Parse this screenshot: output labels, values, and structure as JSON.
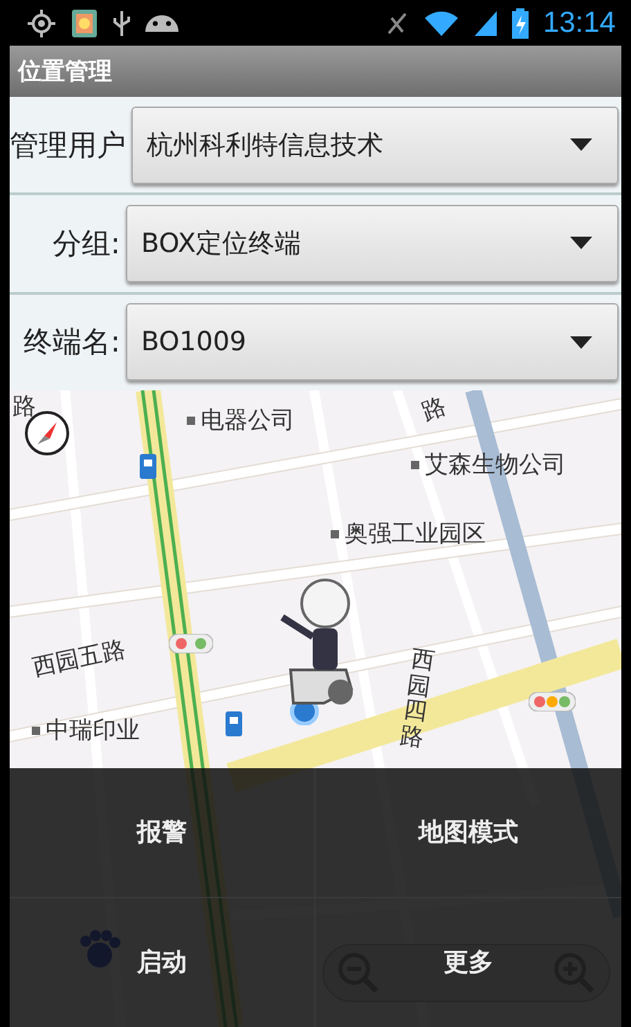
{
  "status_bar": {
    "time": "13:14"
  },
  "title_bar": {
    "title": "位置管理"
  },
  "form": [
    {
      "label": "管理用户",
      "value": "杭州科利特信息技术"
    },
    {
      "label": "分组:",
      "value": "BOX定位终端"
    },
    {
      "label": "终端名:",
      "value": "BO1009"
    }
  ],
  "map": {
    "labels": [
      {
        "text": "路",
        "kind": "road"
      },
      {
        "text": "电器公司",
        "kind": "poi"
      },
      {
        "text": "路",
        "kind": "road"
      },
      {
        "text": "艾森生物公司",
        "kind": "poi"
      },
      {
        "text": "奥强工业园区",
        "kind": "poi"
      },
      {
        "text": "西园五路",
        "kind": "road"
      },
      {
        "text": "中瑞印业",
        "kind": "poi"
      },
      {
        "text": "西园四路",
        "kind": "vroad"
      }
    ]
  },
  "menu": [
    {
      "label": "报警"
    },
    {
      "label": "地图模式"
    },
    {
      "label": "启动"
    },
    {
      "label": "更多"
    }
  ]
}
